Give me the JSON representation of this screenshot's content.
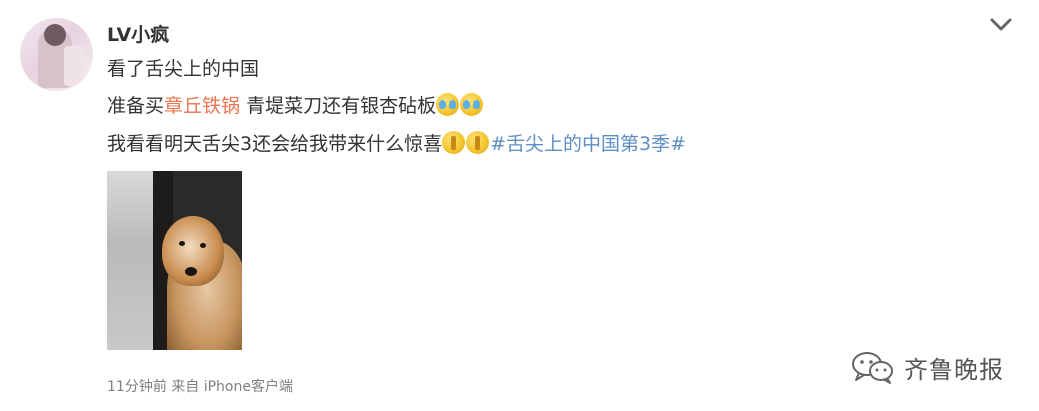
{
  "post": {
    "username": "LV小疯",
    "lines": {
      "line1": "看了舌尖上的中国",
      "line2_prefix": "准备买",
      "line2_link": "章丘铁锅",
      "line2_rest": " 青堤菜刀还有银杏砧板",
      "line3_text": "我看看明天舌尖3还会给我带来什么惊喜",
      "line3_topic": "#舌尖上的中国第3季#"
    },
    "emoji": [
      "crying-laughing-emoji",
      "crying-laughing-emoji",
      "praying-hands-emoji",
      "praying-hands-emoji"
    ],
    "meta": "11分钟前 来自 iPhone客户端"
  },
  "watermark": {
    "text": "齐鲁晚报",
    "icon": "wechat-icon"
  },
  "colors": {
    "link": "#eb7350",
    "topic": "#5d8fc6",
    "meta": "#808080",
    "text": "#333333"
  }
}
